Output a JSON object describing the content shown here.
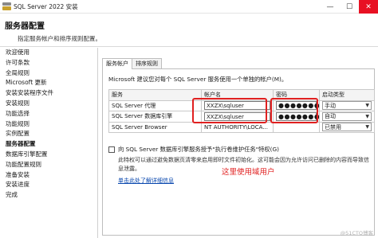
{
  "window": {
    "title": "SQL Server 2022 安装",
    "minimize": "—",
    "maximize": "☐",
    "close": "✕"
  },
  "header": {
    "title": "服务器配置",
    "subtitle": "指定服务帐户和排序规则配置。"
  },
  "sidebar": {
    "items": [
      {
        "label": "欢迎使用"
      },
      {
        "label": "许可条款"
      },
      {
        "label": "全局规则"
      },
      {
        "label": "Microsoft 更新"
      },
      {
        "label": "安装安装程序文件"
      },
      {
        "label": "安装规则"
      },
      {
        "label": "功能选择"
      },
      {
        "label": "功能规则"
      },
      {
        "label": "实例配置"
      },
      {
        "label": "服务器配置"
      },
      {
        "label": "数据库引擎配置"
      },
      {
        "label": "功能配置规则"
      },
      {
        "label": "准备安装"
      },
      {
        "label": "安装进度"
      },
      {
        "label": "完成"
      }
    ],
    "active": "服务器配置"
  },
  "tabs": [
    {
      "label": "服务帐户",
      "active": true
    },
    {
      "label": "排序规则",
      "active": false
    }
  ],
  "service_accounts": {
    "description": "Microsoft 建议您对每个 SQL Server 服务使用一个单独的帐户(M)。",
    "columns": [
      "服务",
      "帐户名",
      "密码",
      "启动类型"
    ],
    "rows": [
      {
        "service": "SQL Server 代理",
        "account": "XXZX\\sqluser",
        "password": "●●●●●●●●●",
        "startup": "手动"
      },
      {
        "service": "SQL Server 数据库引擎",
        "account": "XXZX\\sqluser",
        "password": "●●●●●●●●●",
        "startup": "自动"
      },
      {
        "service": "SQL Server Browser",
        "account": "NT AUTHORITY\\LOCA...",
        "password": "",
        "startup": "已禁用"
      }
    ]
  },
  "grant": {
    "label": "向 SQL Server 数据库引擎服务授予\"执行卷维护任务\"特权(G)",
    "checked": false,
    "note": "此特权可以通过避免数据页清零来启用即时文件初始化。这可能会因为允许访问已删除的内容而导致信息泄露。",
    "link": "单击此处了解详细信息"
  },
  "annotation": "这里使用域用户",
  "watermark": "@51CTO博客",
  "colors": {
    "highlight": "#e02020",
    "link": "#0645ad",
    "close": "#e81123"
  }
}
